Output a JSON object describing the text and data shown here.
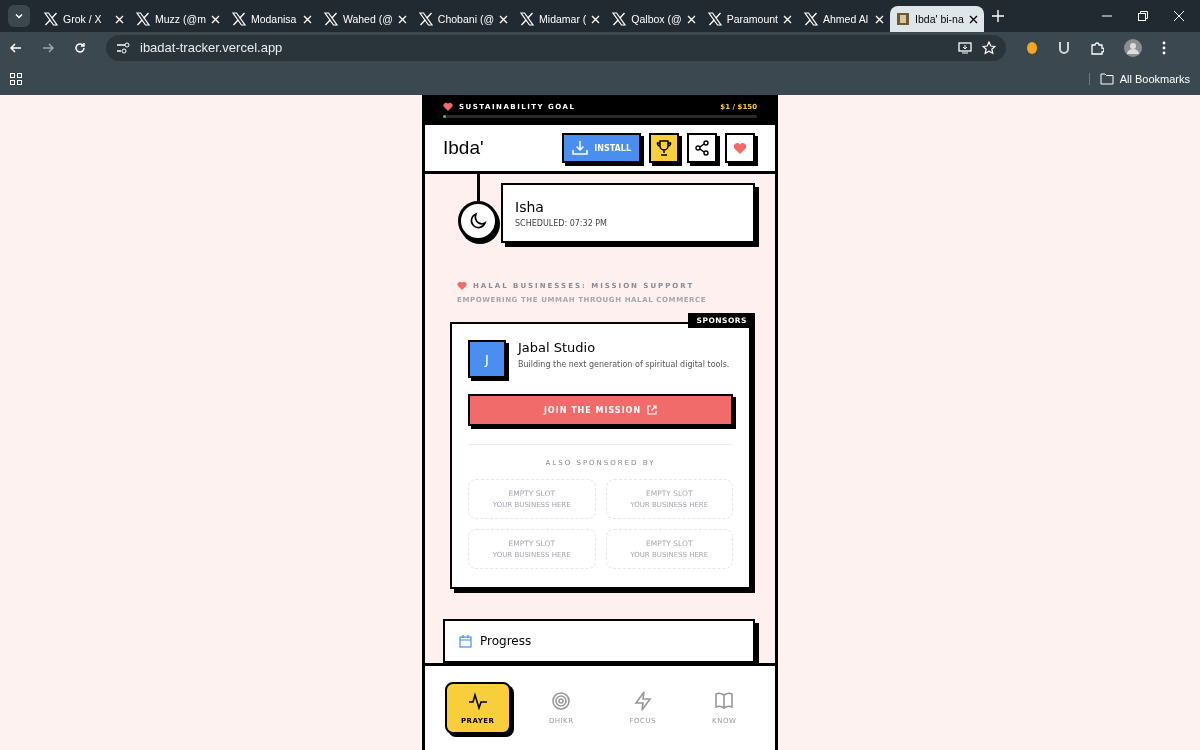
{
  "browser": {
    "tabs": [
      {
        "title": "Grok / X",
        "selected": false,
        "kind": "x"
      },
      {
        "title": "Muzz (@m",
        "selected": false,
        "kind": "x"
      },
      {
        "title": "Modanisa",
        "selected": false,
        "kind": "x"
      },
      {
        "title": "Wahed (@",
        "selected": false,
        "kind": "x"
      },
      {
        "title": "Chobani (@",
        "selected": false,
        "kind": "x"
      },
      {
        "title": "Midamar (",
        "selected": false,
        "kind": "x"
      },
      {
        "title": "Qalbox (@",
        "selected": false,
        "kind": "x"
      },
      {
        "title": "Paramount",
        "selected": false,
        "kind": "x"
      },
      {
        "title": "Ahmed Al",
        "selected": false,
        "kind": "x"
      },
      {
        "title": "Ibda' bi-na",
        "selected": true,
        "kind": "site"
      }
    ],
    "url": "ibadat-tracker.vercel.app",
    "bookmarks": "All Bookmarks"
  },
  "goal": {
    "label": "SUSTAINABILITY GOAL",
    "amount": "$1 / $150",
    "level": 0.007
  },
  "header": {
    "title": "Ibda'",
    "install": "INSTALL"
  },
  "prayer": {
    "name": "Isha",
    "time": "SCHEDULED: 07:32 PM"
  },
  "sponsors": {
    "heading": "HALAL BUSINESSES: MISSION SUPPORT",
    "subheading": "EMPOWERING THE UMMAH THROUGH HALAL COMMERCE",
    "badge": "SPONSORS",
    "sponsor": {
      "initial": "J",
      "name": "Jabal Studio",
      "description": "Building the next generation of spiritual digital tools."
    },
    "cta": "JOIN THE MISSION",
    "also": "ALSO SPONSORED BY",
    "slots": [
      {
        "title": "EMPTY SLOT",
        "note": "YOUR BUSINESS HERE"
      },
      {
        "title": "EMPTY SLOT",
        "note": "YOUR BUSINESS HERE"
      },
      {
        "title": "EMPTY SLOT",
        "note": "YOUR BUSINESS HERE"
      },
      {
        "title": "EMPTY SLOT",
        "note": "YOUR BUSINESS HERE"
      }
    ]
  },
  "progress_card": {
    "title": "Progress"
  },
  "nav": [
    {
      "label": "PRAYER",
      "selected": true,
      "kind": "pulse"
    },
    {
      "label": "DHIKR",
      "selected": false,
      "kind": "target"
    },
    {
      "label": "FOCUS",
      "selected": false,
      "kind": "bolt"
    },
    {
      "label": "KNOW",
      "selected": false,
      "kind": "book"
    }
  ]
}
